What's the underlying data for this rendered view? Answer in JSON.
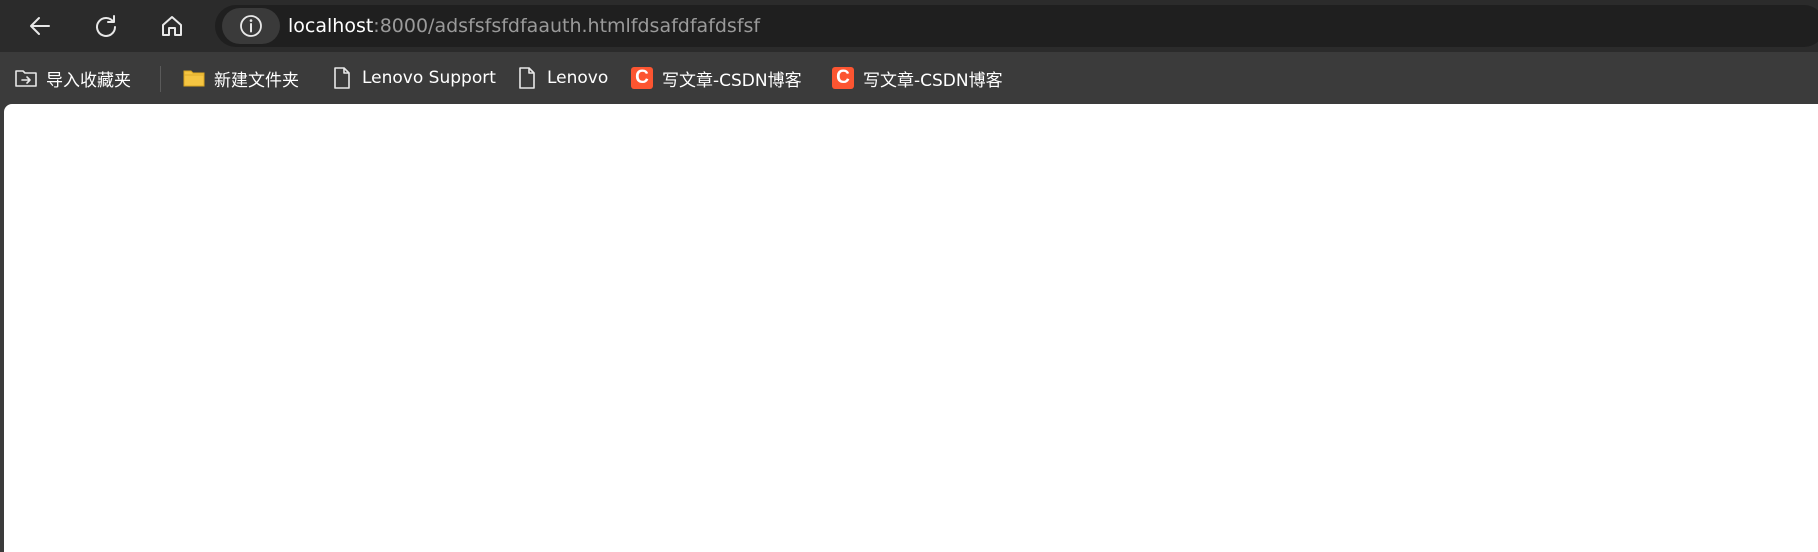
{
  "toolbar": {
    "back_icon": "arrow-left-icon",
    "refresh_icon": "refresh-icon",
    "home_icon": "home-icon"
  },
  "address_bar": {
    "info_icon": "info-icon",
    "url_host": "localhost",
    "url_rest": ":8000/adsfsfsfdfaauth.htmlfdsafdfafdsfsf"
  },
  "bookmarks": [
    {
      "label": "导入收藏夹",
      "icon": "import-favorites-icon"
    },
    {
      "label": "新建文件夹",
      "icon": "folder-icon"
    },
    {
      "label": "Lenovo Support",
      "icon": "page-icon"
    },
    {
      "label": "Lenovo",
      "icon": "page-icon"
    },
    {
      "label": "写文章-CSDN博客",
      "icon": "csdn-icon",
      "icon_text": "C"
    },
    {
      "label": "写文章-CSDN博客",
      "icon": "csdn-icon",
      "icon_text": "C"
    }
  ],
  "colors": {
    "toolbar_bg": "#2b2b2b",
    "bookmarks_bg": "#3b3b3b",
    "csdn_brand": "#fc5531",
    "folder_yellow": "#f5c542"
  }
}
